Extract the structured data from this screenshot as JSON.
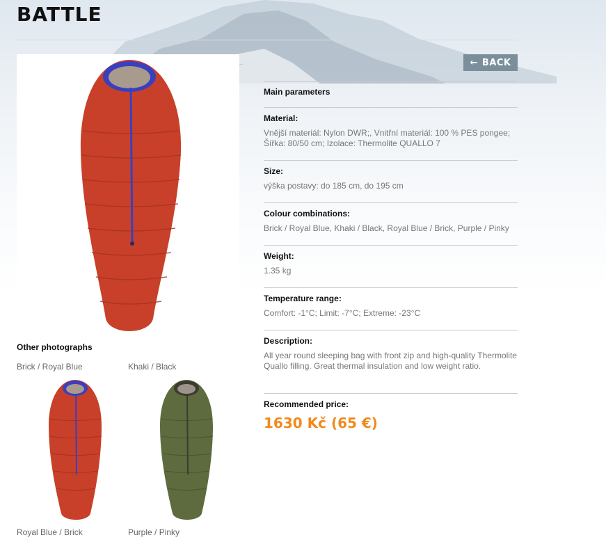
{
  "page": {
    "title": "BATTLE"
  },
  "nav": {
    "back_label": "BACK"
  },
  "colors": {
    "accent_price": "#f08a1c",
    "button_bg": "#7a8f9b",
    "bag_red": "#c8402a",
    "bag_khaki": "#5d6b3e",
    "zip_blue": "#3a3fc0"
  },
  "gallery": {
    "title": "Other photographs",
    "thumbnails": [
      {
        "label": "Brick / Royal Blue",
        "color": "brick"
      },
      {
        "label": "Khaki / Black",
        "color": "khaki"
      },
      {
        "label": "Royal Blue / Brick",
        "color": "brick"
      },
      {
        "label": "Purple / Pinky",
        "color": "khaki"
      }
    ]
  },
  "params": {
    "main_label": "Main parameters",
    "material": {
      "label": "Material:",
      "value": "Vnější materiál: Nylon DWR;, Vnitřní materiál: 100 % PES pongee; Šířka: 80/50 cm; Izolace: Thermolite QUALLO 7"
    },
    "size": {
      "label": "Size:",
      "value": "výška postavy: do 185 cm, do 195 cm"
    },
    "colours": {
      "label": "Colour combinations:",
      "value": "Brick / Royal Blue, Khaki / Black, Royal Blue / Brick, Purple / Pinky"
    },
    "weight": {
      "label": "Weight:",
      "value": "1.35 kg"
    },
    "temperature": {
      "label": "Temperature range:",
      "value": "Comfort: -1°C; Limit: -7°C; Extreme: -23°C"
    },
    "description": {
      "label": "Description:",
      "value": "All year round sleeping bag with front zip and high-quality Thermolite Quallo filling. Great thermal insulation and low weight ratio."
    },
    "price": {
      "label": "Recommended price:",
      "value": "1630 Kč (65 €)"
    }
  }
}
